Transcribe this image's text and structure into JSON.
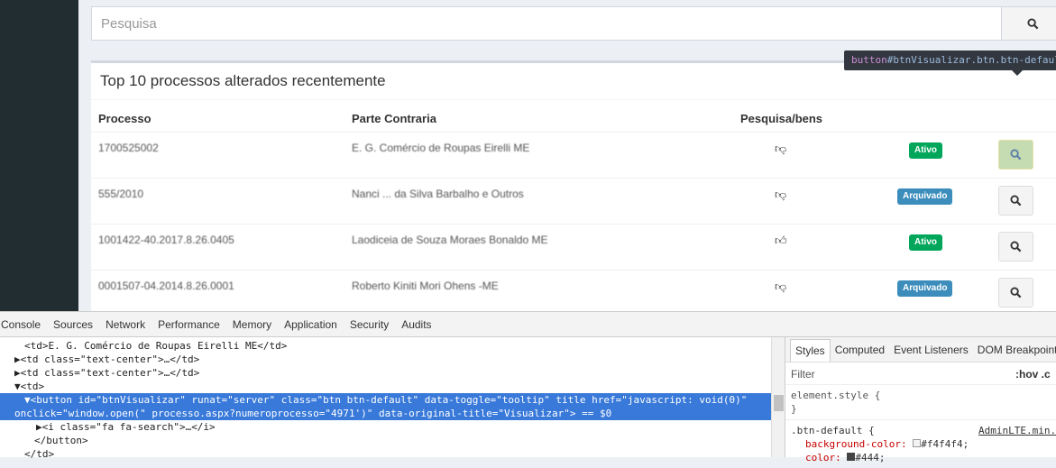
{
  "search": {
    "placeholder": "Pesquisa",
    "icon": "search-icon"
  },
  "box": {
    "title": "Top 10 processos alterados recentemente",
    "headers": {
      "processo": "Processo",
      "parte": "Parte Contraria",
      "pesquisa": "Pesquisa/bens"
    },
    "rows": [
      {
        "processo": "1700525002",
        "parte": "E. G. Comércio de Roupas Eirelli ME",
        "pesquisa": "thumbs-down",
        "status": "Ativo"
      },
      {
        "processo": "555/2010",
        "parte": "Nanci ... da Silva Barbalho e Outros",
        "pesquisa": "thumbs-down",
        "status": "Arquivado"
      },
      {
        "processo": "1001422-40.2017.8.26.0405",
        "parte": "Laodiceia de Souza Moraes Bonaldo ME",
        "pesquisa": "thumbs-up",
        "status": "Ativo"
      },
      {
        "processo": "0001507-04.2014.8.26.0001",
        "parte": "Roberto Kiniti Mori Ohens -ME",
        "pesquisa": "thumbs-down",
        "status": "Arquivado"
      }
    ]
  },
  "tooltip": {
    "tag": "button",
    "selector": "#btnVisualizar.btn.btn-default"
  },
  "devtools": {
    "tabs": [
      "Console",
      "Sources",
      "Network",
      "Performance",
      "Memory",
      "Application",
      "Security",
      "Audits"
    ],
    "lines": {
      "l1": "<td>E. G. Comércio de Roupas Eirelli ME</td>",
      "l2": "<td class=\"text-center\">…</td>",
      "l3": "<td class=\"text-center\">…</td>",
      "l4": "<td>",
      "l5": "<button id=\"btnVisualizar\" runat=\"server\" class=\"btn btn-default\" data-toggle=\"tooltip\" title href=\"javascript: void(0)\"",
      "l6": "onclick=\"window.open(\" processo.aspx?numeroprocesso=\"4971')\" data-original-title=\"Visualizar\"> == $0",
      "l7": "<i class=\"fa fa-search\">…</i>",
      "l8": "</button>",
      "l9": "</td>"
    },
    "styles": {
      "tabs": [
        "Styles",
        "Computed",
        "Event Listeners",
        "DOM Breakpoints"
      ],
      "filter": "Filter",
      "hov": ":hov  .c",
      "element_style": "element.style {",
      "close": "}",
      "rule": ".btn-default {",
      "source": "AdminLTE.min.",
      "bg_prop": "background-color:",
      "bg_val": "#f4f4f4;",
      "color_prop": "color:",
      "color_val": "#444;"
    }
  },
  "colors": {
    "ativo": "#00a65a",
    "arquivado": "#3c8dbc",
    "sidebar": "#222d32",
    "selection": "#3879d9"
  }
}
